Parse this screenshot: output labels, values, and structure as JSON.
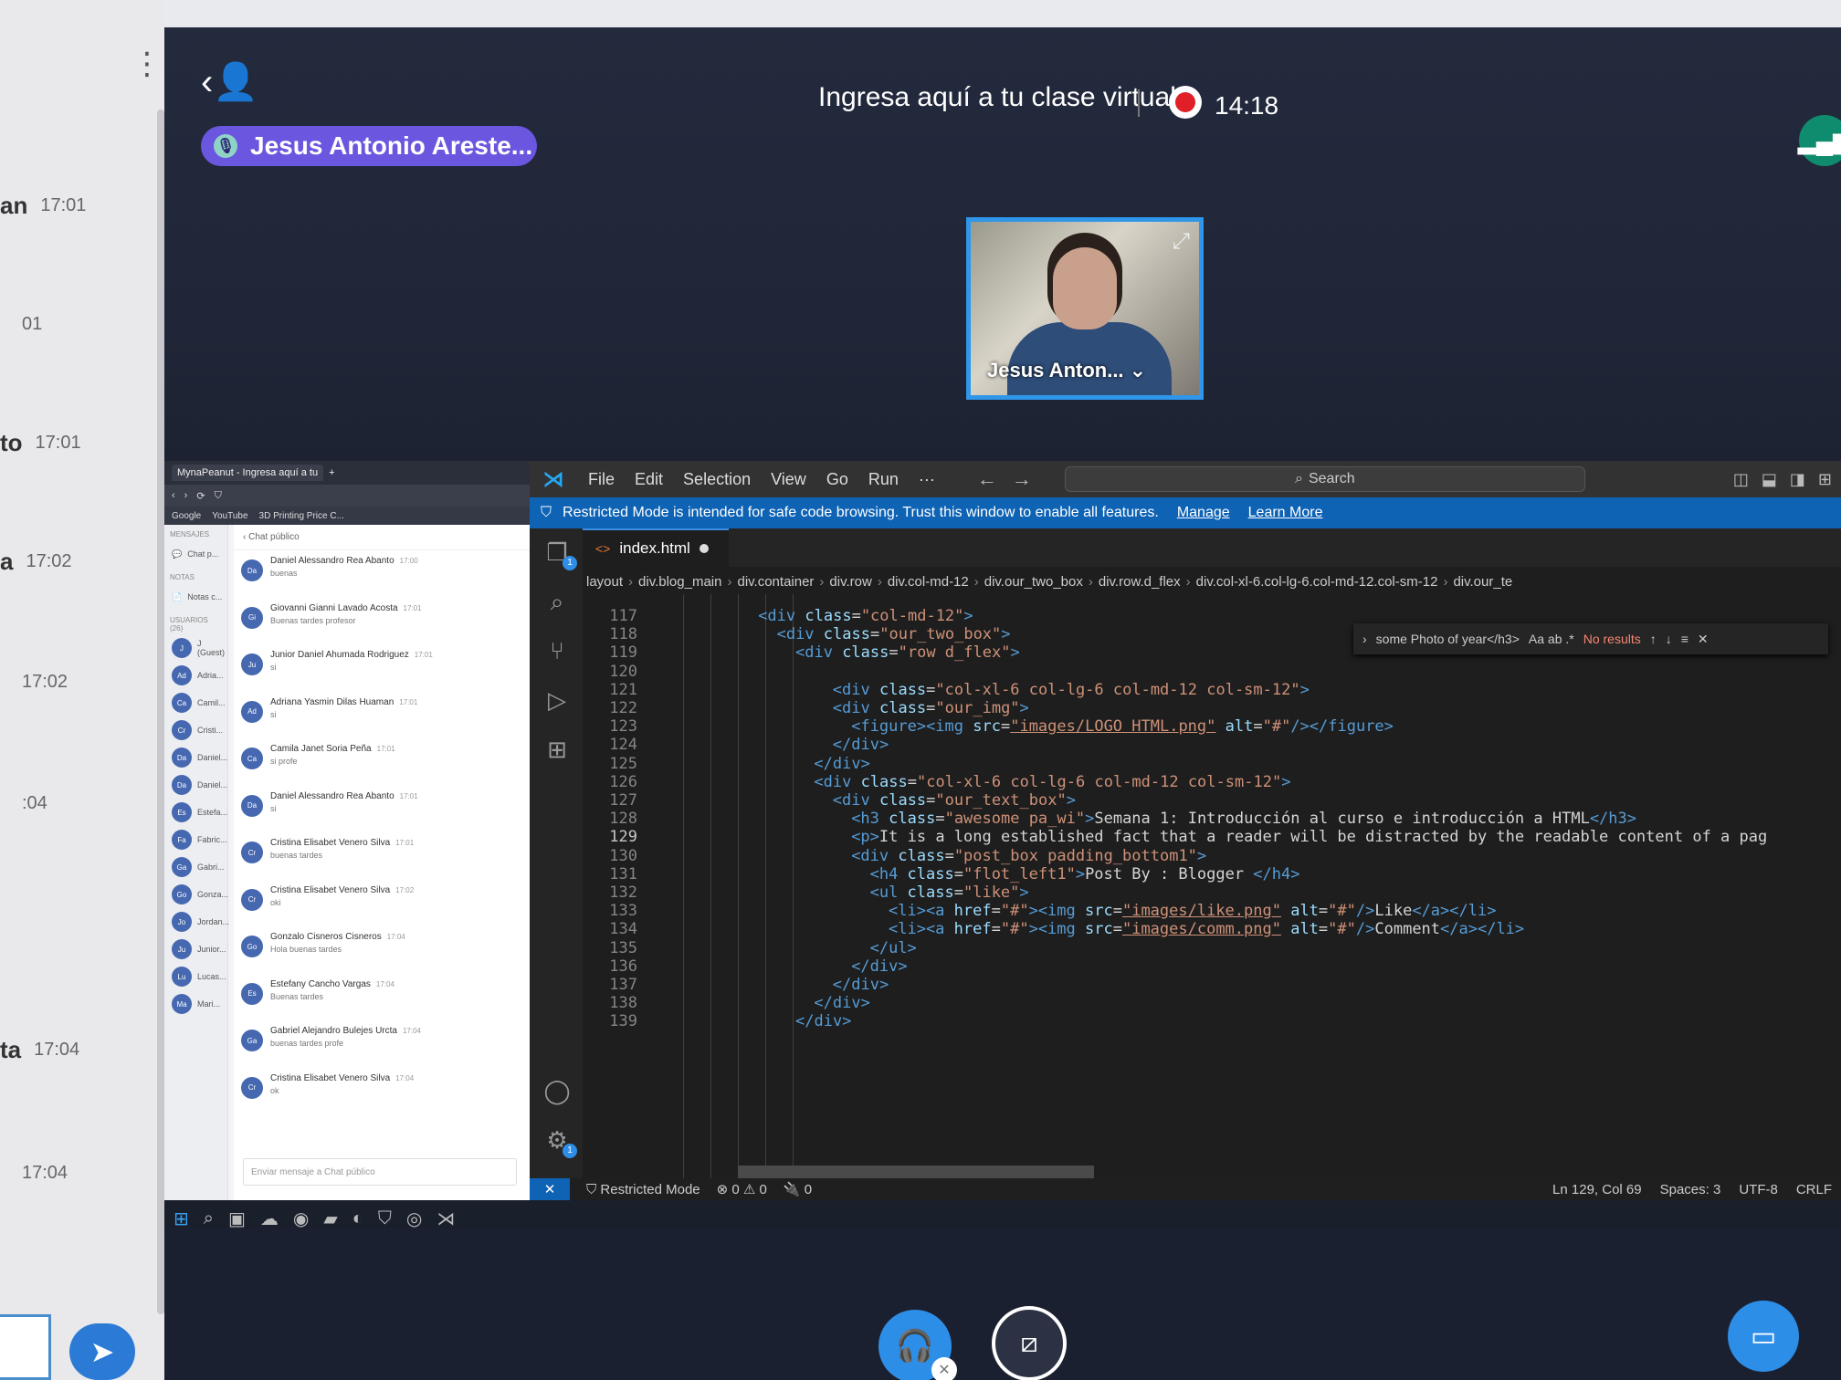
{
  "left_panel": {
    "rows": [
      {
        "name": "an",
        "time": "17:01"
      },
      {
        "name": "",
        "time": "01"
      },
      {
        "name": "to",
        "time": "17:01"
      },
      {
        "name": "a",
        "time": "17:02"
      },
      {
        "name": "",
        "time": "17:02"
      },
      {
        "name": "",
        "time": ":04"
      },
      {
        "name": "ta",
        "time": "17:04"
      },
      {
        "name": "",
        "time": "17:04"
      }
    ]
  },
  "meeting": {
    "title": "Ingresa aquí a tu clase virtual",
    "timer": "14:18",
    "speaker": "Jesus Antonio Areste...",
    "video_name": "Jesus Anton..."
  },
  "chat_browser": {
    "tab": "MynaPeanut - Ingresa aquí a tu",
    "bookmarks": [
      "Google",
      "YouTube",
      "3D Printing Price C..."
    ],
    "sections": {
      "messages": "MENSAJES",
      "notes": "NOTAS",
      "users": "USUARIOS (26)"
    },
    "side_items": [
      "Chat p...",
      "Notas c...",
      "J (Guest)",
      "Adria...",
      "Camil...",
      "Cristi...",
      "Daniel...",
      "Daniel...",
      "Estefa...",
      "Fabric...",
      "Gabri...",
      "Gonza...",
      "Jordan...",
      "Junior...",
      "Lucas...",
      "Mari..."
    ],
    "header": "Chat público",
    "messages": [
      {
        "initials": "Da",
        "name": "Daniel Alessandro Rea Abanto",
        "time": "17:00",
        "text": "buenas"
      },
      {
        "initials": "Gi",
        "name": "Giovanni Gianni Lavado Acosta",
        "time": "17:01",
        "text": "Buenas tardes profesor"
      },
      {
        "initials": "Ju",
        "name": "Junior Daniel Ahumada Rodriguez",
        "time": "17:01",
        "text": "si"
      },
      {
        "initials": "Ad",
        "name": "Adriana Yasmin Dilas Huaman",
        "time": "17:01",
        "text": "si"
      },
      {
        "initials": "Ca",
        "name": "Camila Janet Soria Peña",
        "time": "17:01",
        "text": "si profe"
      },
      {
        "initials": "Da",
        "name": "Daniel Alessandro Rea Abanto",
        "time": "17:01",
        "text": "si"
      },
      {
        "initials": "Cr",
        "name": "Cristina Elisabet Venero Silva",
        "time": "17:01",
        "text": "buenas tardes"
      },
      {
        "initials": "Cr",
        "name": "Cristina Elisabet Venero Silva",
        "time": "17:02",
        "text": "oki"
      },
      {
        "initials": "Go",
        "name": "Gonzalo Cisneros Cisneros",
        "time": "17:04",
        "text": "Hola buenas tardes"
      },
      {
        "initials": "Es",
        "name": "Estefany Cancho Vargas",
        "time": "17:04",
        "text": "Buenas tardes"
      },
      {
        "initials": "Ga",
        "name": "Gabriel Alejandro Bulejes Urcta",
        "time": "17:04",
        "text": "buenas tardes profe"
      },
      {
        "initials": "Cr",
        "name": "Cristina Elisabet Venero Silva",
        "time": "17:04",
        "text": "ok"
      }
    ],
    "input_placeholder": "Enviar mensaje a Chat público"
  },
  "vscode": {
    "menu": [
      "File",
      "Edit",
      "Selection",
      "View",
      "Go",
      "Run",
      "···"
    ],
    "search_placeholder": "Search",
    "banner": {
      "text": "Restricted Mode is intended for safe code browsing. Trust this window to enable all features.",
      "manage": "Manage",
      "learn_more": "Learn More"
    },
    "tab": "index.html",
    "breadcrumb": [
      "layout",
      "div.blog_main",
      "div.container",
      "div.row",
      "div.col-md-12",
      "div.our_two_box",
      "div.row.d_flex",
      "div.col-xl-6.col-lg-6.col-md-12.col-sm-12",
      "div.our_te"
    ],
    "find": {
      "query": "some Photo of year</h3>",
      "results": "No results",
      "options": "Aa ab .*"
    },
    "lines": [
      {
        "n": "117",
        "indent": 11,
        "segments": [
          [
            "tag",
            "<div "
          ],
          [
            "attr",
            "class"
          ],
          [
            "txt",
            "="
          ],
          [
            "str",
            "\"col-md-12\""
          ],
          [
            "tag",
            ">"
          ]
        ]
      },
      {
        "n": "118",
        "indent": 13,
        "segments": [
          [
            "tag",
            "<div "
          ],
          [
            "attr",
            "class"
          ],
          [
            "txt",
            "="
          ],
          [
            "str",
            "\"our_two_box\""
          ],
          [
            "tag",
            ">"
          ]
        ]
      },
      {
        "n": "119",
        "indent": 15,
        "segments": [
          [
            "tag",
            "<div "
          ],
          [
            "attr",
            "class"
          ],
          [
            "txt",
            "="
          ],
          [
            "str",
            "\"row d_flex\""
          ],
          [
            "tag",
            ">"
          ]
        ]
      },
      {
        "n": "120",
        "indent": 0,
        "segments": []
      },
      {
        "n": "121",
        "indent": 19,
        "segments": [
          [
            "tag",
            "<div "
          ],
          [
            "attr",
            "class"
          ],
          [
            "txt",
            "="
          ],
          [
            "str",
            "\"col-xl-6 col-lg-6 col-md-12 col-sm-12\""
          ],
          [
            "tag",
            ">"
          ]
        ]
      },
      {
        "n": "122",
        "indent": 19,
        "segments": [
          [
            "tag",
            "<div "
          ],
          [
            "attr",
            "class"
          ],
          [
            "txt",
            "="
          ],
          [
            "str",
            "\"our_img\""
          ],
          [
            "tag",
            ">"
          ]
        ]
      },
      {
        "n": "123",
        "indent": 21,
        "segments": [
          [
            "tag",
            "<figure><img "
          ],
          [
            "attr",
            "src"
          ],
          [
            "txt",
            "="
          ],
          [
            "link",
            "\"images/LOGO HTML.png\""
          ],
          [
            "attr",
            " alt"
          ],
          [
            "txt",
            "="
          ],
          [
            "str",
            "\"#\""
          ],
          [
            "tag",
            "/></figure>"
          ]
        ]
      },
      {
        "n": "124",
        "indent": 19,
        "segments": [
          [
            "tag",
            "</div>"
          ]
        ]
      },
      {
        "n": "125",
        "indent": 17,
        "segments": [
          [
            "tag",
            "</div>"
          ]
        ]
      },
      {
        "n": "126",
        "indent": 17,
        "segments": [
          [
            "tag",
            "<div "
          ],
          [
            "attr",
            "class"
          ],
          [
            "txt",
            "="
          ],
          [
            "str",
            "\"col-xl-6 col-lg-6 col-md-12 col-sm-12\""
          ],
          [
            "tag",
            ">"
          ]
        ]
      },
      {
        "n": "127",
        "indent": 19,
        "segments": [
          [
            "tag",
            "<div "
          ],
          [
            "attr",
            "class"
          ],
          [
            "txt",
            "="
          ],
          [
            "str",
            "\"our_text_box\""
          ],
          [
            "tag",
            ">"
          ]
        ]
      },
      {
        "n": "128",
        "indent": 21,
        "segments": [
          [
            "tag",
            "<h3 "
          ],
          [
            "attr",
            "class"
          ],
          [
            "txt",
            "="
          ],
          [
            "str",
            "\"awesome pa_wi\""
          ],
          [
            "tag",
            ">"
          ],
          [
            "txt",
            "Semana 1: Introducción al curso e introducción a HTML"
          ],
          [
            "tag",
            "</h3>"
          ]
        ]
      },
      {
        "n": "129",
        "indent": 21,
        "segments": [
          [
            "tag",
            "<p>"
          ],
          [
            "txt",
            "It is a long established fact that a reader will be distracted by the readable content of a pag"
          ]
        ]
      },
      {
        "n": "130",
        "indent": 21,
        "segments": [
          [
            "tag",
            "<div "
          ],
          [
            "attr",
            "class"
          ],
          [
            "txt",
            "="
          ],
          [
            "str",
            "\"post_box padding_bottom1\""
          ],
          [
            "tag",
            ">"
          ]
        ]
      },
      {
        "n": "131",
        "indent": 23,
        "segments": [
          [
            "tag",
            "<h4 "
          ],
          [
            "attr",
            "class"
          ],
          [
            "txt",
            "="
          ],
          [
            "str",
            "\"flot_left1\""
          ],
          [
            "tag",
            ">"
          ],
          [
            "txt",
            "Post By : Blogger "
          ],
          [
            "tag",
            "</h4>"
          ]
        ]
      },
      {
        "n": "132",
        "indent": 23,
        "segments": [
          [
            "tag",
            "<ul "
          ],
          [
            "attr",
            "class"
          ],
          [
            "txt",
            "="
          ],
          [
            "str",
            "\"like\""
          ],
          [
            "tag",
            ">"
          ]
        ]
      },
      {
        "n": "133",
        "indent": 25,
        "segments": [
          [
            "tag",
            "<li><a "
          ],
          [
            "attr",
            "href"
          ],
          [
            "txt",
            "="
          ],
          [
            "str",
            "\"#\""
          ],
          [
            "tag",
            "><img "
          ],
          [
            "attr",
            "src"
          ],
          [
            "txt",
            "="
          ],
          [
            "link",
            "\"images/like.png\""
          ],
          [
            "attr",
            " alt"
          ],
          [
            "txt",
            "="
          ],
          [
            "str",
            "\"#\""
          ],
          [
            "tag",
            "/>"
          ],
          [
            "txt",
            "Like"
          ],
          [
            "tag",
            "</a></li>"
          ]
        ]
      },
      {
        "n": "134",
        "indent": 25,
        "segments": [
          [
            "tag",
            "<li><a "
          ],
          [
            "attr",
            "href"
          ],
          [
            "txt",
            "="
          ],
          [
            "str",
            "\"#\""
          ],
          [
            "tag",
            "><img "
          ],
          [
            "attr",
            "src"
          ],
          [
            "txt",
            "="
          ],
          [
            "link",
            "\"images/comm.png\""
          ],
          [
            "attr",
            " alt"
          ],
          [
            "txt",
            "="
          ],
          [
            "str",
            "\"#\""
          ],
          [
            "tag",
            "/>"
          ],
          [
            "txt",
            "Comment"
          ],
          [
            "tag",
            "</a></li>"
          ]
        ]
      },
      {
        "n": "135",
        "indent": 23,
        "segments": [
          [
            "tag",
            "</ul>"
          ]
        ]
      },
      {
        "n": "136",
        "indent": 21,
        "segments": [
          [
            "tag",
            "</div>"
          ]
        ]
      },
      {
        "n": "137",
        "indent": 19,
        "segments": [
          [
            "tag",
            "</div>"
          ]
        ]
      },
      {
        "n": "138",
        "indent": 17,
        "segments": [
          [
            "tag",
            "</div>"
          ]
        ]
      },
      {
        "n": "139",
        "indent": 15,
        "segments": [
          [
            "tag",
            "</div>"
          ]
        ]
      }
    ],
    "current_line": "129",
    "status": {
      "mode": "Restricted Mode",
      "problems": "⊗ 0 ⚠ 0",
      "ports": "🔌 0",
      "position": "Ln 129, Col 69",
      "spaces": "Spaces: 3",
      "encoding": "UTF-8",
      "eol": "CRLF"
    }
  },
  "colors": {
    "accent": "#2d8ee8",
    "speaker_pill": "#6b56e0",
    "recording": "#e01f26",
    "vscode_banner": "#0e63b5"
  },
  "icons": [
    "participants-icon",
    "microphone-icon",
    "record-icon",
    "signal-icon",
    "expand-icon",
    "send-icon",
    "headphones-icon",
    "camera-off-icon",
    "screen-share-icon",
    "vscode-logo-icon",
    "explorer-icon",
    "search-icon",
    "source-control-icon",
    "run-debug-icon",
    "extensions-icon",
    "account-icon",
    "settings-icon"
  ]
}
